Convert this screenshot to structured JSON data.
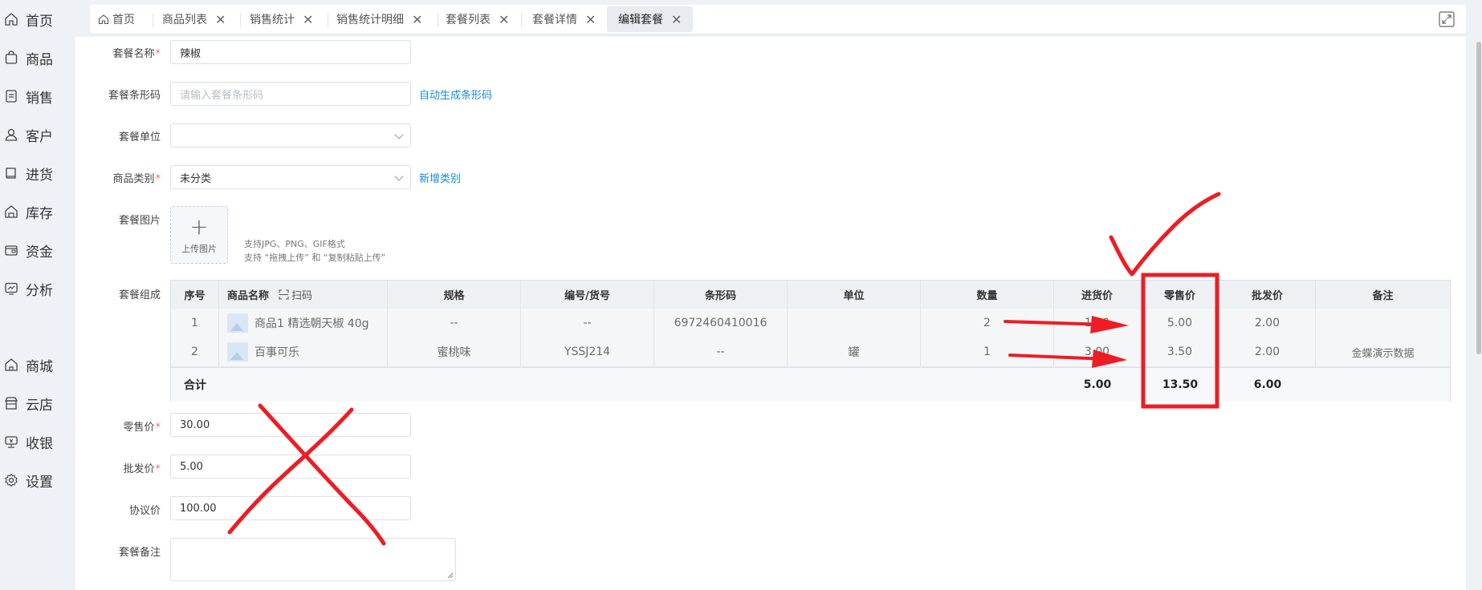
{
  "sidebar": {
    "items": [
      {
        "label": "首页",
        "icon": "home-icon"
      },
      {
        "label": "商品",
        "icon": "bag-icon"
      },
      {
        "label": "销售",
        "icon": "receipt-icon"
      },
      {
        "label": "客户",
        "icon": "user-icon"
      },
      {
        "label": "进货",
        "icon": "book-icon"
      },
      {
        "label": "库存",
        "icon": "warehouse-icon"
      },
      {
        "label": "资金",
        "icon": "wallet-icon"
      },
      {
        "label": "分析",
        "icon": "chart-icon"
      },
      {
        "label": "商城",
        "icon": "shop-icon"
      },
      {
        "label": "云店",
        "icon": "store-icon"
      },
      {
        "label": "收银",
        "icon": "cashier-icon"
      },
      {
        "label": "设置",
        "icon": "gear-icon"
      }
    ]
  },
  "tabs": [
    {
      "label": "首页"
    },
    {
      "label": "商品列表"
    },
    {
      "label": "销售统计"
    },
    {
      "label": "销售统计明细"
    },
    {
      "label": "套餐列表"
    },
    {
      "label": "套餐详情"
    },
    {
      "label": "编辑套餐"
    }
  ],
  "form": {
    "name_label": "套餐名称",
    "name_value": "辣椒",
    "barcode_label": "套餐条形码",
    "barcode_placeholder": "请输入套餐条形码",
    "barcode_link": "自动生成条形码",
    "unit_label": "套餐单位",
    "category_label": "商品类别",
    "category_value": "未分类",
    "category_link": "新增类别",
    "image_label": "套餐图片",
    "upload_text": "上传图片",
    "hint1": "支持JPG、PNG、GIF格式",
    "hint2": "支持 “拖拽上传” 和 “复制粘贴上传”",
    "composition_label": "套餐组成",
    "retail_label": "零售价",
    "retail_value": "30.00",
    "wholesale_label": "批发价",
    "wholesale_value": "5.00",
    "agreement_label": "协议价",
    "agreement_value": "100.00",
    "remark_label": "套餐备注",
    "remark_value": ""
  },
  "table": {
    "headers": [
      "序号",
      "商品名称",
      "扫码",
      "规格",
      "编号/货号",
      "条形码",
      "单位",
      "数量",
      "进货价",
      "零售价",
      "批发价",
      "备注"
    ],
    "rows": [
      {
        "no": "1",
        "name": "商品1 精选朝天椒 40g",
        "spec": "--",
        "code": "--",
        "barcode": "6972460410016",
        "unit": "",
        "qty": "2",
        "purchase": "1.00",
        "retail": "5.00",
        "wholesale": "2.00",
        "remark": ""
      },
      {
        "no": "2",
        "name": "百事可乐",
        "spec": "蜜桃味",
        "code": "YSSJ214",
        "barcode": "--",
        "unit": "罐",
        "qty": "1",
        "purchase": "3.00",
        "retail": "3.50",
        "wholesale": "2.00",
        "remark": "金蝶演示数据"
      }
    ],
    "total": {
      "label": "合计",
      "purchase": "5.00",
      "retail": "13.50",
      "wholesale": "6.00"
    }
  },
  "annotation_colors": {
    "mark": "#ee1c24"
  }
}
